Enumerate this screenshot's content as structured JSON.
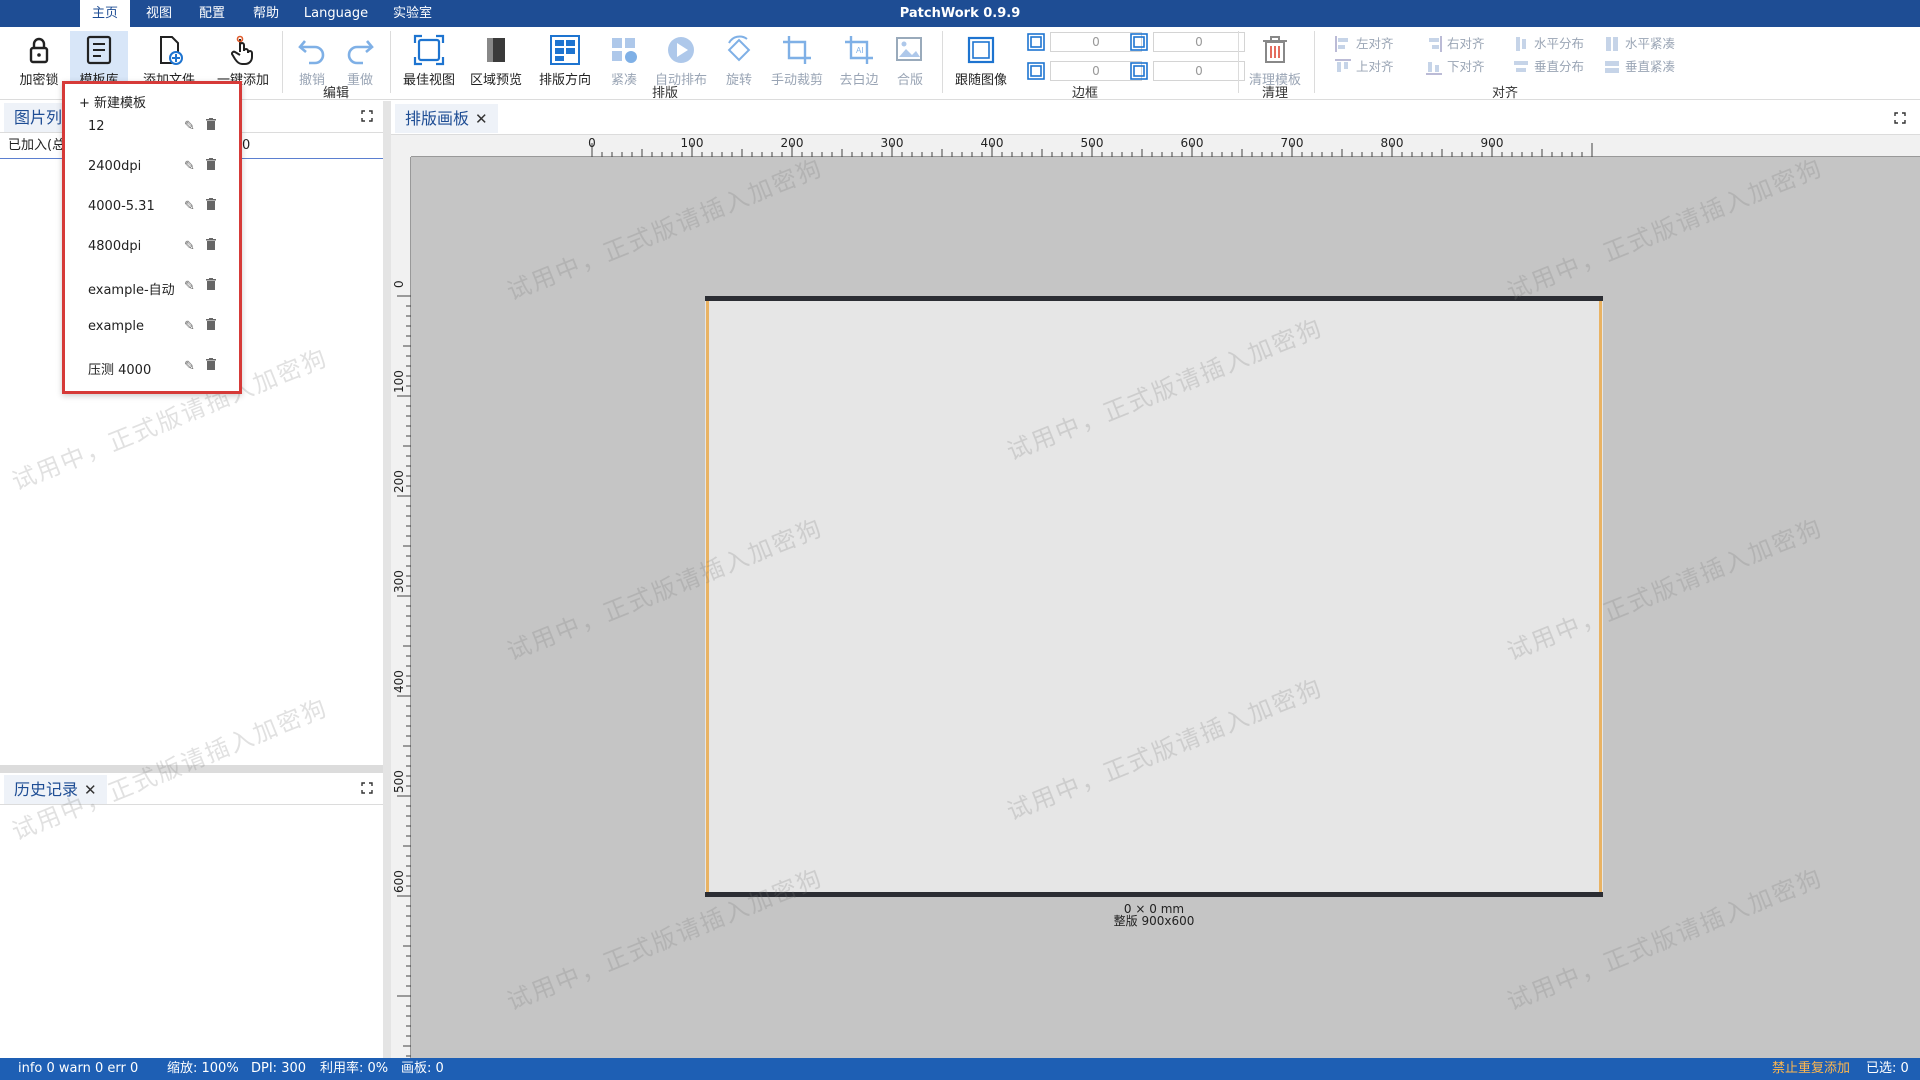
{
  "menu": {
    "tabs": [
      "主页",
      "视图",
      "配置",
      "帮助",
      "Language",
      "实验室"
    ],
    "app_title": "PatchWork 0.9.9"
  },
  "ribbon": {
    "buttons": [
      "加密锁",
      "模板库",
      "添加文件",
      "一键添加",
      "撤销",
      "重做",
      "最佳视图",
      "区域预览",
      "排版方向",
      "紧凑",
      "自动排布",
      "旋转",
      "手动裁剪",
      "去白边",
      "合版",
      "跟随图像",
      "清理模板"
    ],
    "groups": {
      "edit": "编辑",
      "layout": "排版",
      "border": "边框",
      "clean": "清理",
      "align": "对齐"
    },
    "border_values": [
      "0",
      "0",
      "0",
      "0"
    ],
    "align": [
      "左对齐",
      "右对齐",
      "水平分布",
      "水平紧凑",
      "上对齐",
      "下对齐",
      "垂直分布",
      "垂直紧凑"
    ]
  },
  "left": {
    "image_list_title": "图片列表",
    "image_list_sub": "已加入(总",
    "image_list_sub_tail": "0",
    "history_title": "历史记录"
  },
  "canvas": {
    "tab_title": "排版画板",
    "ruler_top": [
      "0",
      "100",
      "200",
      "300",
      "400",
      "500",
      "600",
      "700",
      "800",
      "900"
    ],
    "ruler_left": [
      "0",
      "100",
      "200",
      "300",
      "400",
      "500",
      "600"
    ],
    "board_size": "0 × 0 mm",
    "board_label": "整版  900x600"
  },
  "template_menu": {
    "new_label": "+ 新建模板",
    "items": [
      "12",
      "2400dpi",
      "4000-5.31",
      "4800dpi",
      "example-自动",
      "example",
      "压测 4000"
    ],
    "edit_glyph": "✎"
  },
  "status": {
    "logs": "info 0  warn 0  err 0",
    "zoom": "缩放: 100%",
    "dpi": "DPI: 300",
    "usage": "利用率: 0%",
    "boards": "画板: 0",
    "no_dup": "禁止重复添加",
    "selected": "已选: 0"
  },
  "watermark": "试用中，正式版请插入加密狗",
  "colors": {
    "title_bar": "#1e4d94",
    "status_bar": "#1e5fb4",
    "highlight": "#d63a38",
    "board_edge": "#e9b364"
  }
}
